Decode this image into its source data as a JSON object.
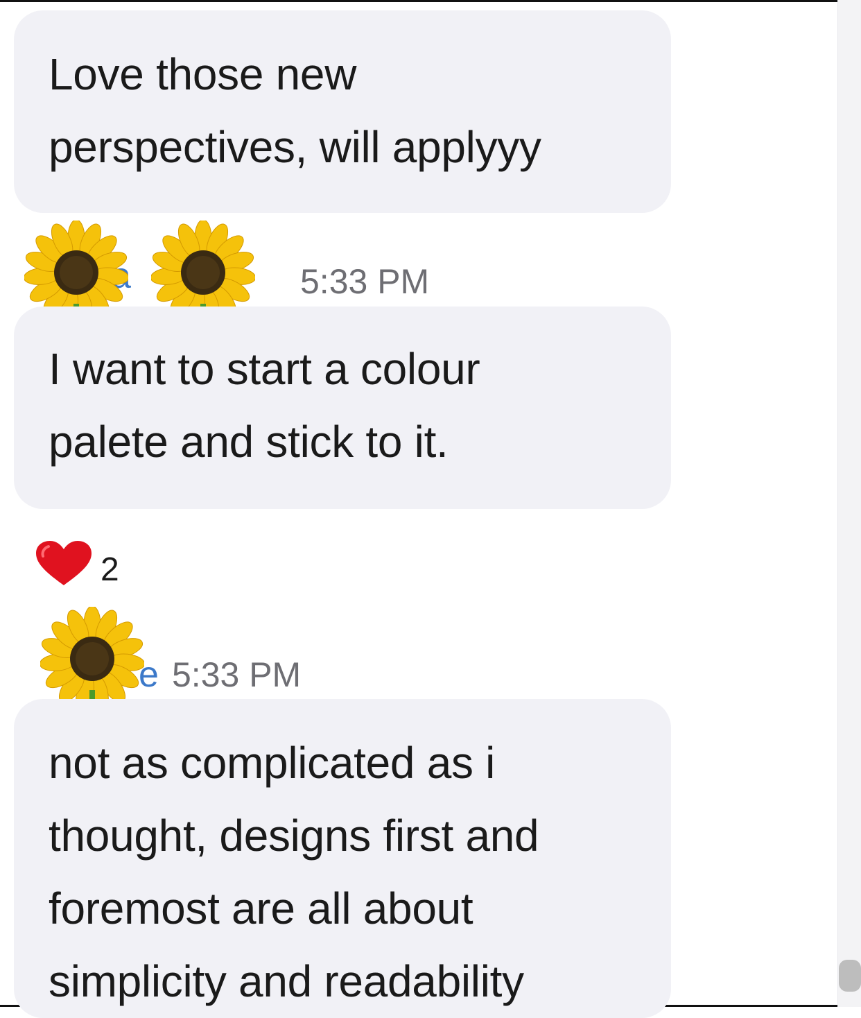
{
  "messages": [
    {
      "text_lines": [
        "Love those new",
        "perspectives, will applyyy"
      ]
    },
    {
      "sender": "a ol",
      "time": "5:33 PM",
      "text_lines": [
        "I want to start a colour",
        "palete and stick to it."
      ]
    },
    {
      "sender": "e",
      "time": "5:33 PM",
      "text_lines": [
        "not as complicated as i",
        "thought, designs first and",
        "foremost are all about",
        "simplicity and readability"
      ]
    }
  ],
  "reaction": {
    "icon": "heart-icon",
    "count": "2"
  },
  "colors": {
    "bubble": "#f1f1f6",
    "sender": "#3c79c9",
    "time": "#6e6e73",
    "heart": "#e0121f"
  }
}
